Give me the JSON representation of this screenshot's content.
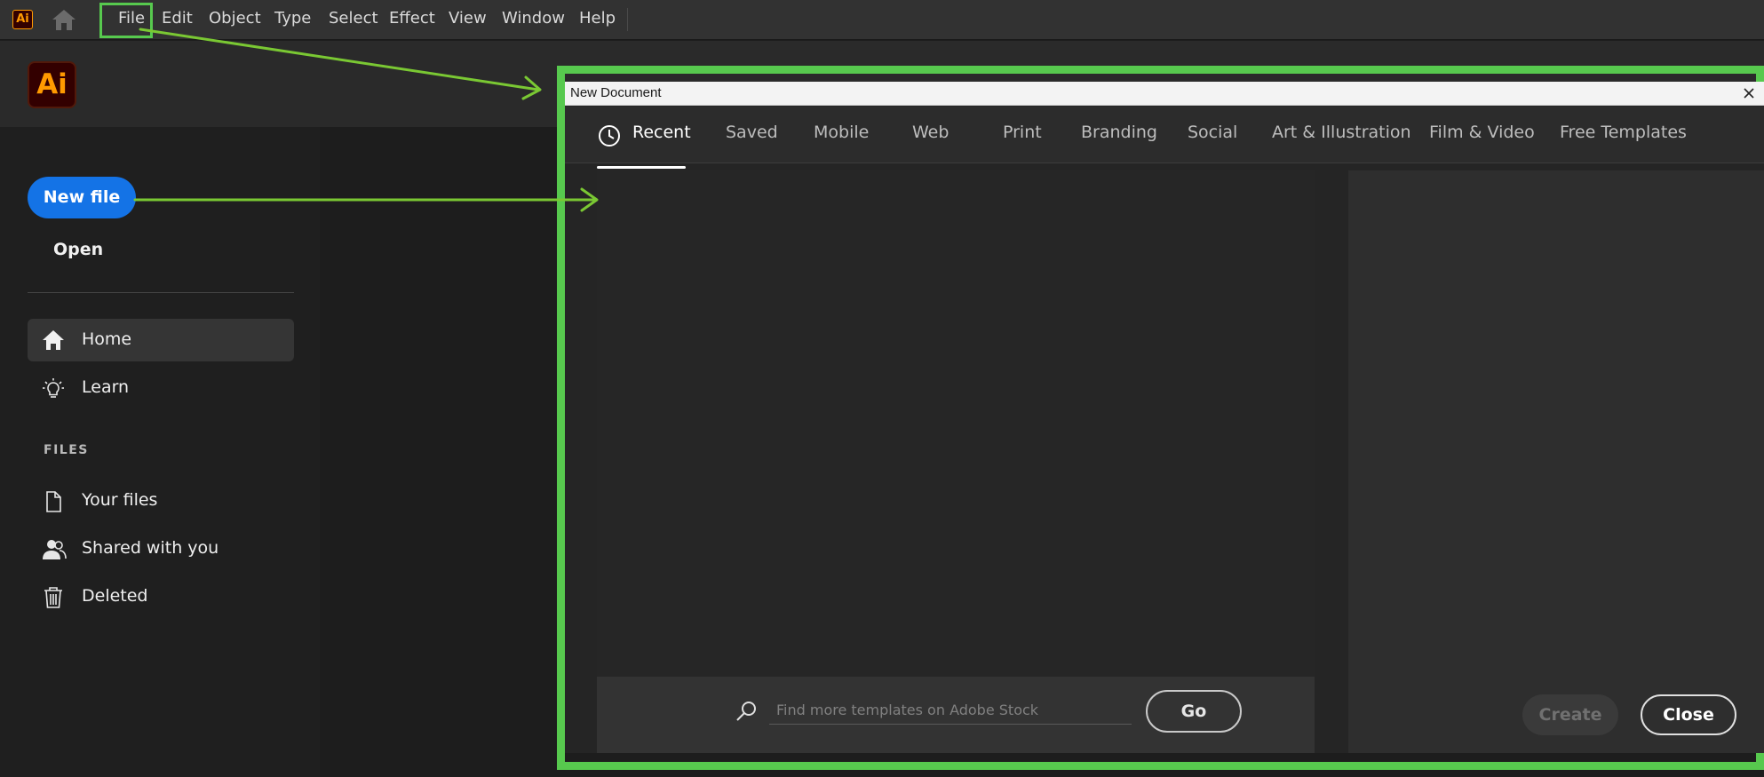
{
  "menubar": {
    "app_badge": "Ai",
    "items": [
      "File",
      "Edit",
      "Object",
      "Type",
      "Select",
      "Effect",
      "View",
      "Window",
      "Help"
    ]
  },
  "home": {
    "logo": "Ai",
    "new_file": "New file",
    "open": "Open",
    "nav": [
      {
        "label": "Home",
        "icon": "home-icon"
      },
      {
        "label": "Learn",
        "icon": "lightbulb-icon"
      }
    ],
    "files_heading": "FILES",
    "files": [
      {
        "label": "Your files",
        "icon": "document-icon"
      },
      {
        "label": "Shared with you",
        "icon": "users-icon"
      },
      {
        "label": "Deleted",
        "icon": "trash-icon"
      }
    ]
  },
  "dialog": {
    "title": "New Document",
    "tabs": [
      "Recent",
      "Saved",
      "Mobile",
      "Web",
      "Print",
      "Branding",
      "Social",
      "Art & Illustration",
      "Film & Video",
      "Free Templates"
    ],
    "active_tab": "Recent",
    "search": {
      "placeholder": "Find more templates on Adobe Stock",
      "value": "",
      "go": "Go"
    },
    "create": "Create",
    "close": "Close"
  },
  "colors": {
    "accent": "#1473e6",
    "highlight": "#57c94e",
    "annotation_arrow": "#7ac833",
    "ai_brand": "#ff9a00"
  }
}
